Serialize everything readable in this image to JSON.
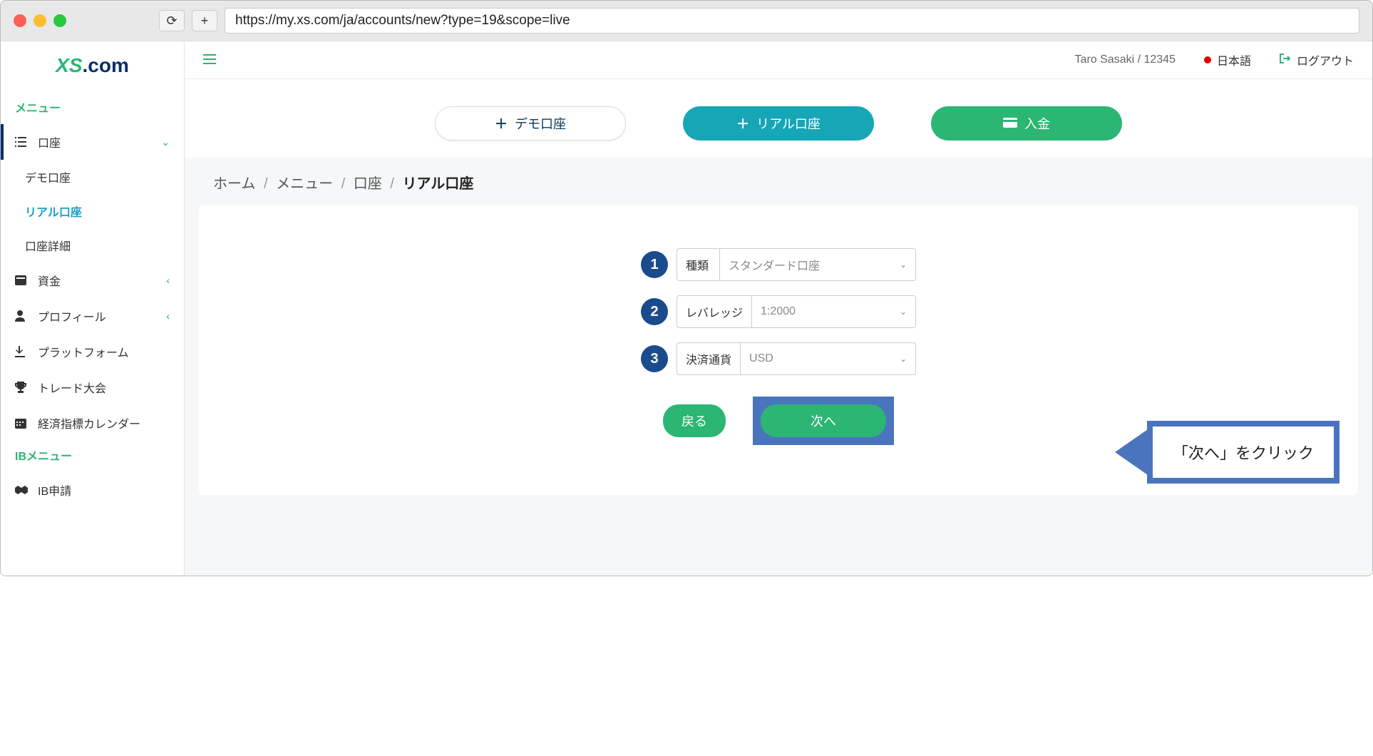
{
  "browser": {
    "url": "https://my.xs.com/ja/accounts/new?type=19&scope=live"
  },
  "logo": {
    "xs": "XS",
    "com": ".com"
  },
  "sidebar": {
    "menu_title": "メニュー",
    "accounts": "口座",
    "demo_account": "デモ口座",
    "live_account": "リアル口座",
    "account_detail": "口座詳細",
    "funds": "資金",
    "profile": "プロフィール",
    "platform": "プラットフォーム",
    "trade_contest": "トレード大会",
    "eco_calendar": "経済指標カレンダー",
    "ib_menu_title": "IBメニュー",
    "ib_apply": "IB申請"
  },
  "topbar": {
    "user": "Taro Sasaki / 12345",
    "lang": "日本語",
    "logout": "ログアウト"
  },
  "pills": {
    "demo": "デモ口座",
    "live": "リアル口座",
    "deposit": "入金"
  },
  "breadcrumb": {
    "home": "ホーム",
    "menu": "メニュー",
    "accounts": "口座",
    "current": "リアル口座"
  },
  "form": {
    "step1": "1",
    "step2": "2",
    "step3": "3",
    "type_label": "種類",
    "type_value": "スタンダード口座",
    "leverage_label": "レバレッジ",
    "leverage_value": "1:2000",
    "currency_label": "決済通貨",
    "currency_value": "USD",
    "back": "戻る",
    "next": "次へ"
  },
  "callout": {
    "text": "「次へ」をクリック"
  }
}
